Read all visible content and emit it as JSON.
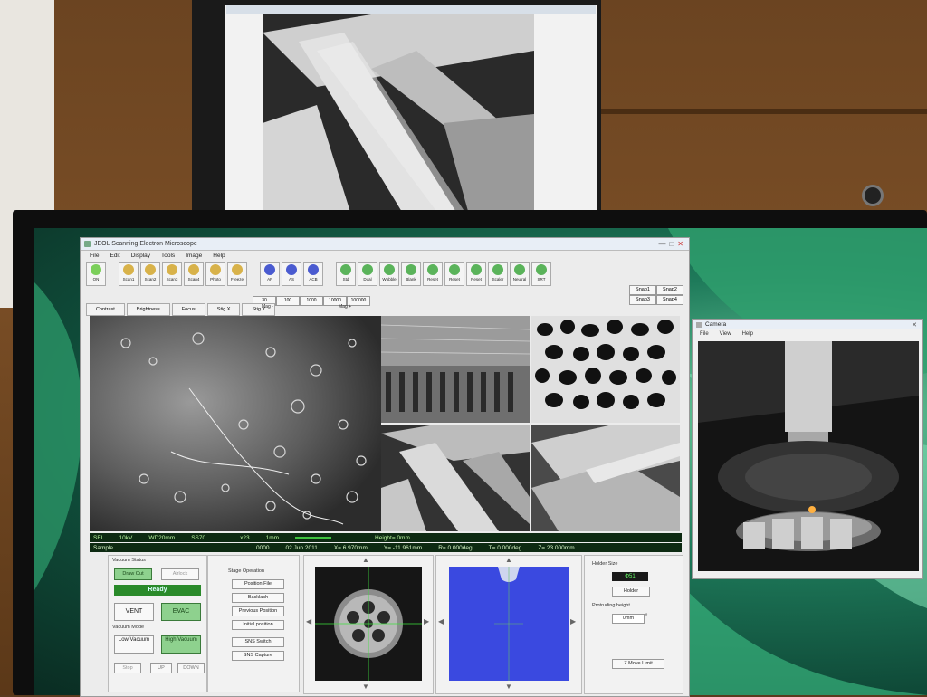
{
  "app": {
    "title": "JEOL Scanning Electron Microscope",
    "window_buttons": [
      "—",
      "□",
      "✕"
    ],
    "menu": [
      "File",
      "Edit",
      "Display",
      "Tools",
      "Image",
      "Help"
    ],
    "toolbar": [
      {
        "label": "ON",
        "icon": "ht-icon",
        "color": "#7bcf5a"
      },
      {
        "label": "Scan1",
        "icon": "scan-icon",
        "color": "#d8b24a"
      },
      {
        "label": "Scan2",
        "icon": "scan-icon",
        "color": "#d8b24a"
      },
      {
        "label": "Scan3",
        "icon": "scan-icon",
        "color": "#d8b24a"
      },
      {
        "label": "Scan4",
        "icon": "scan-icon",
        "color": "#d8b24a"
      },
      {
        "label": "Photo",
        "icon": "photo-icon",
        "color": "#d8b24a"
      },
      {
        "label": "Freeze",
        "icon": "freeze-icon",
        "color": "#d8b24a"
      },
      {
        "label": "AF",
        "icon": "af-icon",
        "color": "#4a5bd0"
      },
      {
        "label": "AS",
        "icon": "as-icon",
        "color": "#4a5bd0"
      },
      {
        "label": "ACB",
        "icon": "acb-icon",
        "color": "#4a5bd0"
      },
      {
        "label": "Std",
        "icon": "std-icon",
        "color": "#5ab35a"
      },
      {
        "label": "Dual",
        "icon": "dual-icon",
        "color": "#5ab35a"
      },
      {
        "label": "Wobble",
        "icon": "wobble-icon",
        "color": "#5ab35a"
      },
      {
        "label": "Blank",
        "icon": "blank-icon",
        "color": "#5ab35a"
      },
      {
        "label": "Reset",
        "icon": "reset-icon",
        "color": "#5ab35a"
      },
      {
        "label": "Reset",
        "icon": "reset-icon",
        "color": "#5ab35a"
      },
      {
        "label": "Reset",
        "icon": "reset-icon",
        "color": "#5ab35a"
      },
      {
        "label": "Scaler",
        "icon": "scaler-icon",
        "color": "#5ab35a"
      },
      {
        "label": "Neutral",
        "icon": "neutral-icon",
        "color": "#5ab35a"
      },
      {
        "label": "SRT",
        "icon": "srt-icon",
        "color": "#5ab35a"
      }
    ],
    "snaps": [
      "Snap1",
      "Snap2",
      "Snap3",
      "Snap4"
    ],
    "mag_buttons": [
      "30",
      "100",
      "1000",
      "10000",
      "100000"
    ],
    "tabs": [
      "Contrast",
      "Brightness",
      "Focus",
      "Stig X",
      "Stig Y"
    ],
    "mag_minus": "Mag -",
    "mag_plus": "Mag +",
    "status1": {
      "mode": "SEI",
      "kv": "10kV",
      "wd": "WD20mm",
      "ss": "SS70",
      "mag": "x23",
      "scale": "1mm",
      "height": "Height= 0mm"
    },
    "status2": {
      "sample": "Sample",
      "count": "0000",
      "date": "02 Jun 2011",
      "x": "X= 6.970mm",
      "y": "Y= -11.961mm",
      "r": "R= 0.000deg",
      "t": "T= 0.000deg",
      "z": "Z= 23.000mm"
    },
    "vacuum": {
      "title": "Vacuum Status",
      "draw_out": "Draw Out",
      "airlock": "Airlock",
      "status": "Ready",
      "vent": "VENT",
      "evac": "EVAC",
      "mode_title": "Vacuum Mode",
      "low": "Low Vacuum",
      "high": "High Vacuum",
      "stop": "Stop",
      "up": "UP",
      "down": "DOWN"
    },
    "stage": {
      "title": "Stage Operation",
      "buttons": [
        "Position File",
        "Backlash",
        "Previous Position",
        "Initial position",
        "SNS Switch",
        "SNS Capture"
      ]
    },
    "holder": {
      "size_title": "Holder Size",
      "size_value": "Φ51",
      "holder_btn": "Holder",
      "protruding": "Protruding height",
      "protruding_value": "0mm",
      "z_limit": "Z Move Limit"
    }
  },
  "camera": {
    "title": "Camera",
    "menu": [
      "File",
      "View",
      "Help"
    ]
  }
}
